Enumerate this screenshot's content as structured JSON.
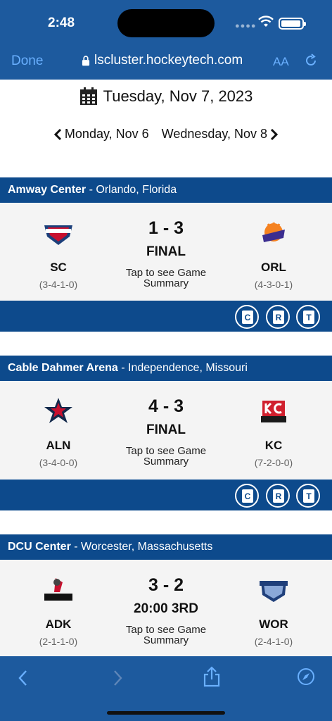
{
  "status": {
    "time": "2:48"
  },
  "browser": {
    "done_label": "Done",
    "url": "lscluster.hockeytech.com",
    "text_size_label": "AA"
  },
  "schedule": {
    "date": "Tuesday, Nov 7, 2023",
    "prev_day": "Monday, Nov 6",
    "next_day": "Wednesday, Nov 8"
  },
  "games": [
    {
      "venue": "Amway Center",
      "location": " - Orlando, Florida",
      "home": {
        "abbr": "SC",
        "record": "(3-4-1-0)"
      },
      "away": {
        "abbr": "ORL",
        "record": "(4-3-0-1)"
      },
      "score": "1 - 3",
      "state": "FINAL",
      "tap_text": "Tap to see Game Summary",
      "actions": [
        "C",
        "R",
        "T"
      ]
    },
    {
      "venue": "Cable Dahmer Arena",
      "location": " - Independence, Missouri",
      "home": {
        "abbr": "ALN",
        "record": "(3-4-0-0)"
      },
      "away": {
        "abbr": "KC",
        "record": "(7-2-0-0)"
      },
      "score": "4 - 3",
      "state": "FINAL",
      "tap_text": "Tap to see Game Summary",
      "actions": [
        "C",
        "R",
        "T"
      ]
    },
    {
      "venue": "DCU Center",
      "location": " - Worcester, Massachusetts",
      "home": {
        "abbr": "ADK",
        "record": "(2-1-1-0)"
      },
      "away": {
        "abbr": "WOR",
        "record": "(2-4-1-0)"
      },
      "score": "3 - 2",
      "state": "20:00 3RD",
      "tap_text": "Tap to see Game Summary"
    }
  ],
  "colors": {
    "browser_bar": "#1d5a9e",
    "venue_bar": "#0d4a8c",
    "link_blue": "#6ab0ff"
  }
}
